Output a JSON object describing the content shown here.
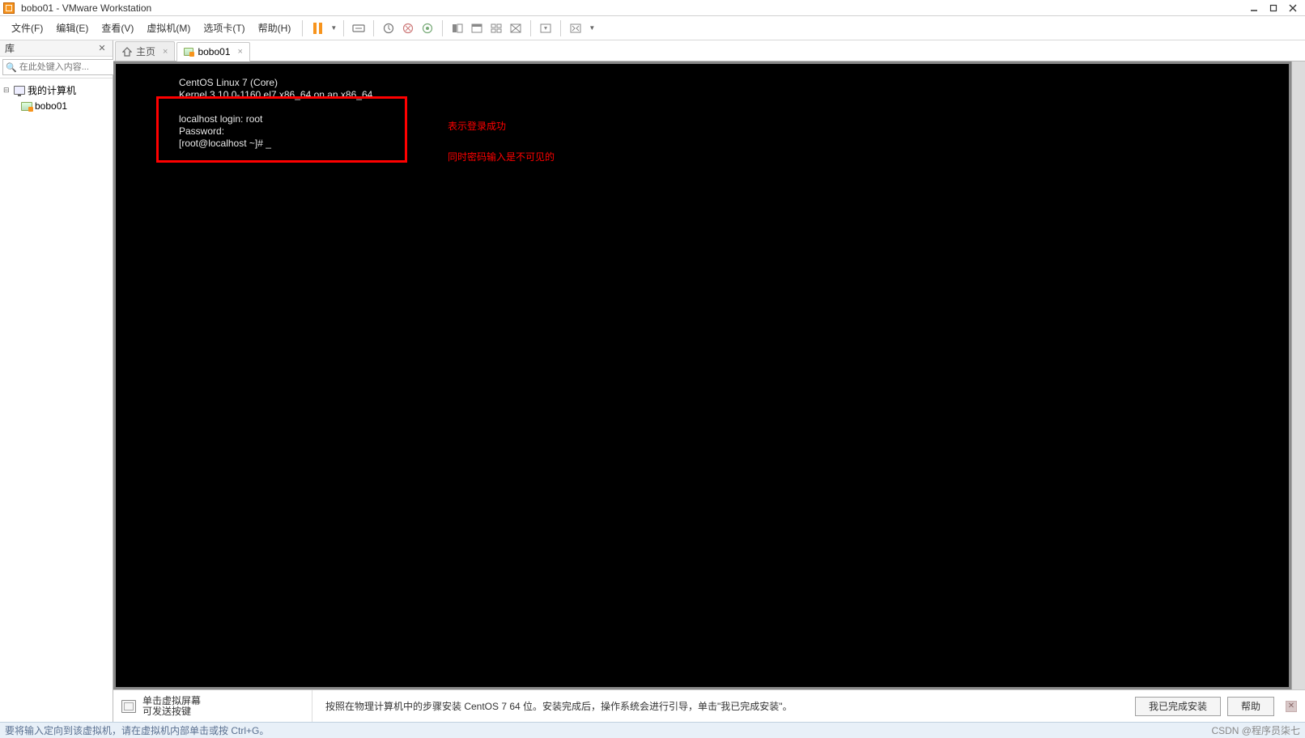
{
  "title": "bobo01 - VMware Workstation",
  "menu": {
    "file": "文件(F)",
    "edit": "编辑(E)",
    "view": "查看(V)",
    "vm": "虚拟机(M)",
    "tabs": "选项卡(T)",
    "help": "帮助(H)"
  },
  "sidebar": {
    "header": "库",
    "search_placeholder": "在此处键入内容...",
    "root": "我的计算机",
    "vm": "bobo01"
  },
  "tabs": {
    "home": "主页",
    "vm": "bobo01"
  },
  "console": {
    "line1": "CentOS Linux 7 (Core)",
    "line2": "Kernel 3.10.0-1160.el7.x86_64 on an x86_64",
    "line3": "",
    "line4": "localhost login: root",
    "line5": "Password:",
    "line6": "[root@localhost ~]# _"
  },
  "annotation": {
    "line1": "表示登录成功",
    "line2": "同时密码输入是不可见的"
  },
  "hint": {
    "left_line1": "单击虚拟屏幕",
    "left_line2": "可发送按键",
    "main": "按照在物理计算机中的步骤安装 CentOS 7 64 位。安装完成后，操作系统会进行引导，单击\"我已完成安装\"。",
    "done_btn": "我已完成安装",
    "help_btn": "帮助"
  },
  "status": {
    "left": "要将输入定向到该虚拟机，请在虚拟机内部单击或按 Ctrl+G。",
    "watermark": "CSDN @程序员柒七"
  }
}
